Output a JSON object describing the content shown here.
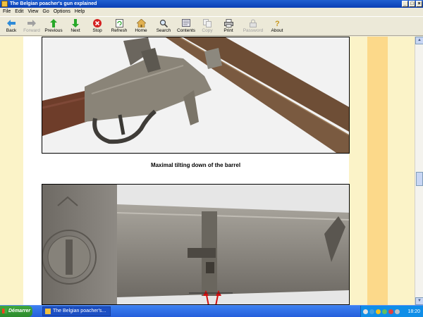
{
  "window": {
    "title": "The Belgian poacher's gun explained"
  },
  "menu": [
    "File",
    "Edit",
    "View",
    "Go",
    "Options",
    "Help"
  ],
  "toolbar": [
    {
      "label": "Back",
      "icon": "back-arrow-icon",
      "enabled": true
    },
    {
      "label": "Forward",
      "icon": "forward-arrow-icon",
      "enabled": false
    },
    {
      "label": "Previous",
      "icon": "up-arrow-icon",
      "enabled": true
    },
    {
      "label": "Next",
      "icon": "down-arrow-icon",
      "enabled": true
    },
    {
      "label": "Stop",
      "icon": "stop-icon",
      "enabled": true
    },
    {
      "label": "Refresh",
      "icon": "refresh-icon",
      "enabled": true
    },
    {
      "label": "Home",
      "icon": "home-icon",
      "enabled": true
    },
    {
      "label": "Search",
      "icon": "search-icon",
      "enabled": true
    },
    {
      "label": "Contents",
      "icon": "contents-icon",
      "enabled": true
    },
    {
      "label": "Copy",
      "icon": "copy-icon",
      "enabled": false
    },
    {
      "label": "Print",
      "icon": "print-icon",
      "enabled": true
    },
    {
      "label": "Password",
      "icon": "password-icon",
      "enabled": false
    },
    {
      "label": "About",
      "icon": "about-icon",
      "enabled": true
    }
  ],
  "page": {
    "caption": "Maximal tilting down of the barrel",
    "colors": {
      "margin_light": "#fbf3c8",
      "margin_accent": "#fcd98a"
    }
  },
  "taskbar": {
    "start_label": "Démarrer",
    "window_item": "The Belgian poacher's...",
    "clock": "18:20"
  }
}
